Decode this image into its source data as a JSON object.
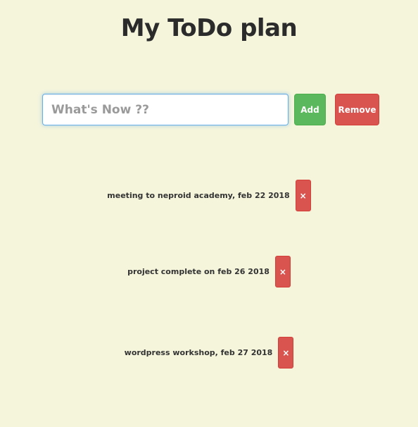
{
  "header": {
    "title": "My ToDo plan"
  },
  "form": {
    "input_placeholder": "What's Now ??",
    "input_value": "",
    "add_label": "Add",
    "remove_label": "Remove"
  },
  "todos": [
    {
      "text": "meeting to neproid academy, feb 22 2018",
      "delete_label": "×"
    },
    {
      "text": "project complete on feb 26 2018",
      "delete_label": "×"
    },
    {
      "text": "wordpress workshop, feb 27 2018",
      "delete_label": "×"
    }
  ],
  "colors": {
    "background": "#f5f5dc",
    "add_button": "#5cb85c",
    "remove_button": "#d9534f",
    "input_focus_border": "#66afe9"
  }
}
